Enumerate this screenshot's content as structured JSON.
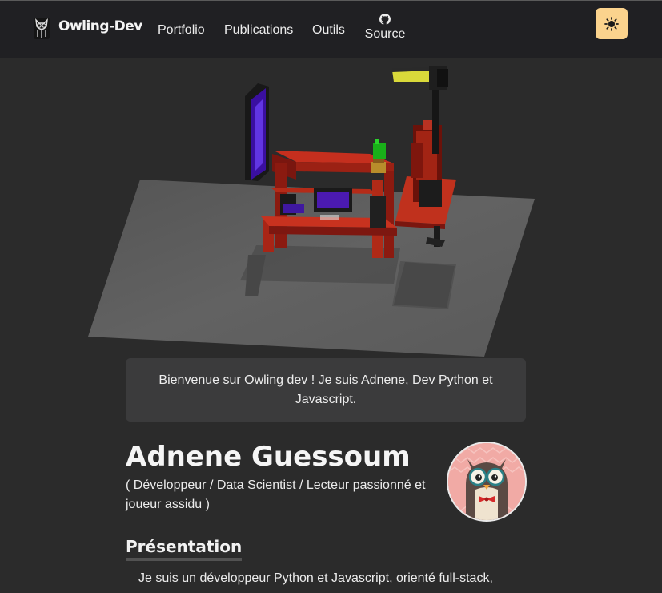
{
  "nav": {
    "brand": "Owling-Dev",
    "links": [
      "Portfolio",
      "Publications",
      "Outils"
    ],
    "source_label": "Source",
    "icons": {
      "logo": "owl-logo-icon",
      "source": "github-icon",
      "theme": "sun-icon"
    },
    "theme_button_color": "#fbd38d"
  },
  "welcome": {
    "text": "Bienvenue sur Owling dev ! Je suis Adnene, Dev Python et Javascript."
  },
  "profile": {
    "name": "Adnene Guessoum",
    "subtitle": "( Développeur / Data Scientist / Lecteur passionné et joueur assidu )"
  },
  "presentation": {
    "title": "Présentation",
    "text": "Je suis un développeur Python et Javascript, orienté full-stack,"
  },
  "colors": {
    "background": "#2b2b2b",
    "navbar": "#202023",
    "card": "#3b3b3c",
    "accent": "#fbd38d"
  }
}
